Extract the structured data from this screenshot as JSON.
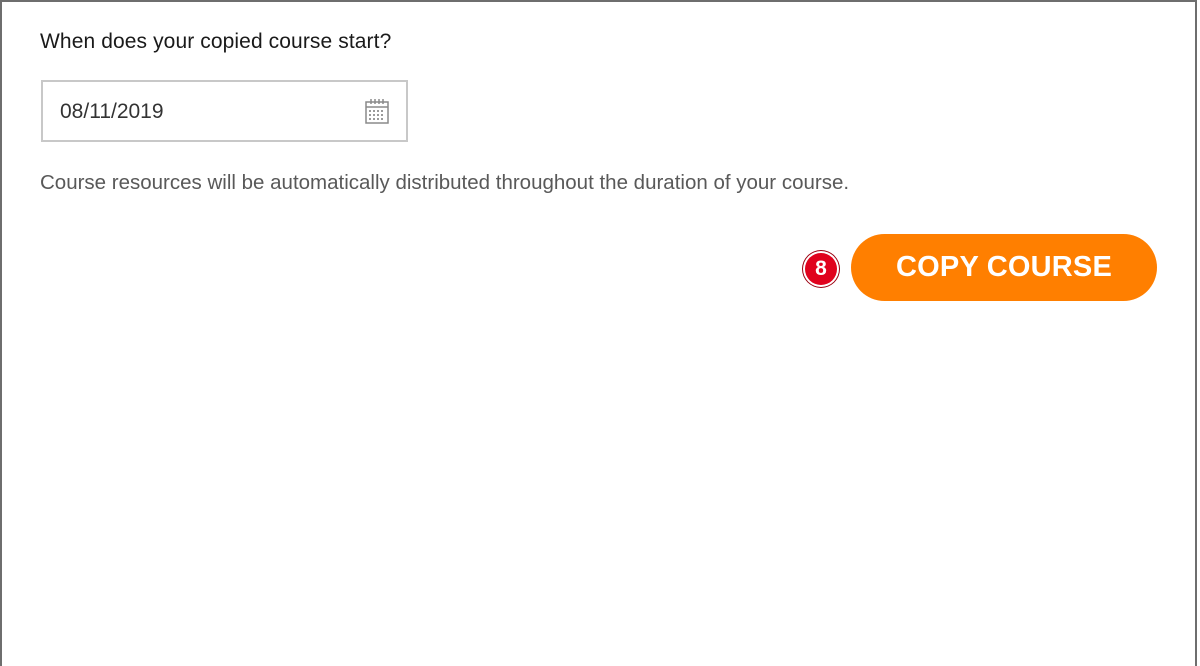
{
  "form": {
    "question": "When does your copied course start?",
    "start_date_value": "08/11/2019",
    "calendar_icon": "calendar-icon",
    "helper_text": "Course resources will be automatically distributed throughout the duration of your course."
  },
  "actions": {
    "step_number": "8",
    "copy_course_label": "COPY COURSE"
  },
  "colors": {
    "accent": "#ff7f00",
    "badge": "#e0021d",
    "border": "#c8c8c8",
    "frame": "#6e6e6e"
  }
}
